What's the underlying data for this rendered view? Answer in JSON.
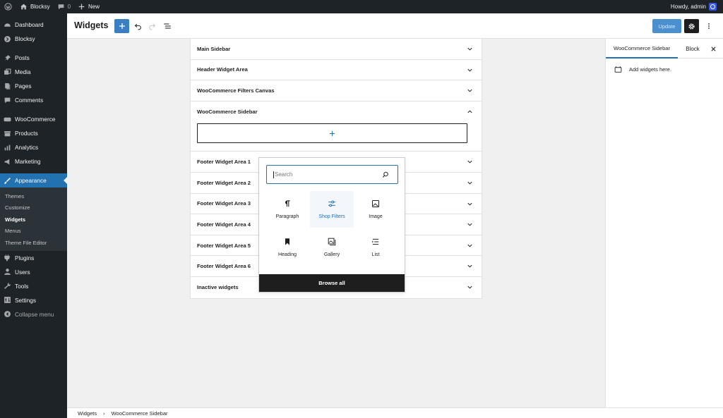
{
  "adminbar": {
    "site_name": "Blocksy",
    "comments_count": "0",
    "new_label": "New",
    "howdy": "Howdy, admin"
  },
  "menu": {
    "dashboard": "Dashboard",
    "blocksy": "Blocksy",
    "posts": "Posts",
    "media": "Media",
    "pages": "Pages",
    "comments": "Comments",
    "woocommerce": "WooCommerce",
    "products": "Products",
    "analytics": "Analytics",
    "marketing": "Marketing",
    "appearance": "Appearance",
    "submenu": [
      "Themes",
      "Customize",
      "Widgets",
      "Menus",
      "Theme File Editor"
    ],
    "plugins": "Plugins",
    "users": "Users",
    "tools": "Tools",
    "settings": "Settings",
    "collapse": "Collapse menu"
  },
  "header": {
    "title": "Widgets",
    "update_label": "Update"
  },
  "widget_areas": {
    "main_sidebar": "Main Sidebar",
    "header_widget_area": "Header Widget Area",
    "filters_canvas": "WooCommerce Filters Canvas",
    "woo_sidebar": "WooCommerce Sidebar",
    "footer_1": "Footer Widget Area 1",
    "footer_2": "Footer Widget Area 2",
    "footer_3": "Footer Widget Area 3",
    "footer_4": "Footer Widget Area 4",
    "footer_5": "Footer Widget Area 5",
    "footer_6": "Footer Widget Area 6",
    "inactive": "Inactive widgets"
  },
  "inserter": {
    "search_placeholder": "Search",
    "blocks": [
      "Paragraph",
      "Shop Filters",
      "Image",
      "Heading",
      "Gallery",
      "List"
    ],
    "browse_all": "Browse all"
  },
  "inspector": {
    "tab_area": "WooCommerce Sidebar",
    "tab_block": "Block",
    "empty_text": "Add widgets here."
  },
  "breadcrumb": {
    "root": "Widgets",
    "current": "WooCommerce Sidebar"
  },
  "colors": {
    "admin_dark": "#1d2327",
    "accent": "#2271b1"
  }
}
